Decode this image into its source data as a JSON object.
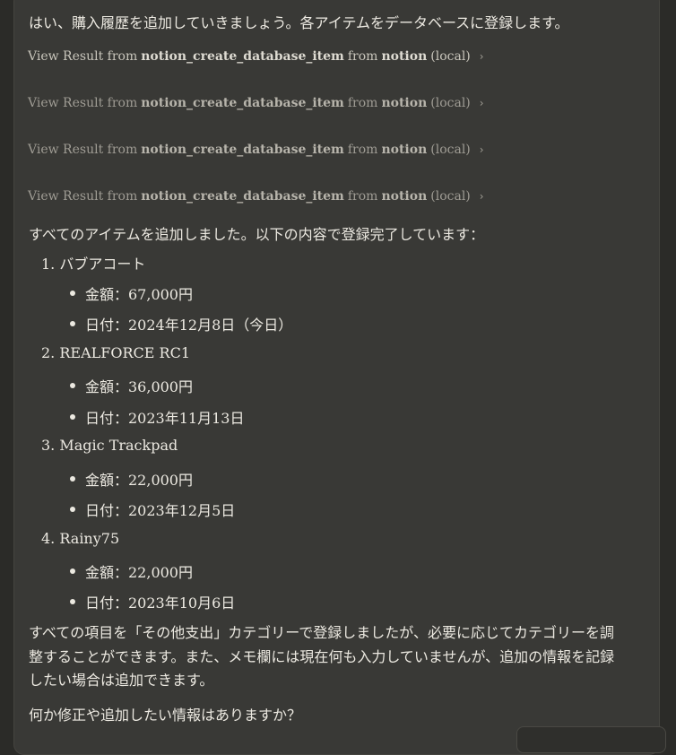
{
  "intro": "はい、購入履歴を追加していきましょう。各アイテムをデータベースに登録します。",
  "tool_calls": [
    {
      "prefix": "View Result from",
      "tool": "notion_create_database_item",
      "mid": "from",
      "server": "notion",
      "suffix": "(local)"
    },
    {
      "prefix": "View Result from",
      "tool": "notion_create_database_item",
      "mid": "from",
      "server": "notion",
      "suffix": "(local)"
    },
    {
      "prefix": "View Result from",
      "tool": "notion_create_database_item",
      "mid": "from",
      "server": "notion",
      "suffix": "(local)"
    },
    {
      "prefix": "View Result from",
      "tool": "notion_create_database_item",
      "mid": "from",
      "server": "notion",
      "suffix": "(local)"
    }
  ],
  "summary": "すべてのアイテムを追加しました。以下の内容で登録完了しています：",
  "items": [
    {
      "num": "1.",
      "name": "バブアコート",
      "price": "金額：67,000円",
      "date": "日付：2024年12月8日（今日）"
    },
    {
      "num": "2.",
      "name": "REALFORCE RC1",
      "price": "金額：36,000円",
      "date": "日付：2023年11月13日"
    },
    {
      "num": "3.",
      "name": "Magic Trackpad",
      "price": "金額：22,000円",
      "date": "日付：2023年12月5日"
    },
    {
      "num": "4.",
      "name": "Rainy75",
      "price": "金額：22,000円",
      "date": "日付：2023年10月6日"
    }
  ],
  "note_lines": [
    "すべての項目を「その他支出」カテゴリーで登録しましたが、必要に応じてカテゴリーを調",
    "整することができます。また、メモ欄には現在何も入力していませんが、追加の情報を記録",
    "したい場合は追加できます。"
  ],
  "question": "何か修正や追加したい情報はありますか？"
}
